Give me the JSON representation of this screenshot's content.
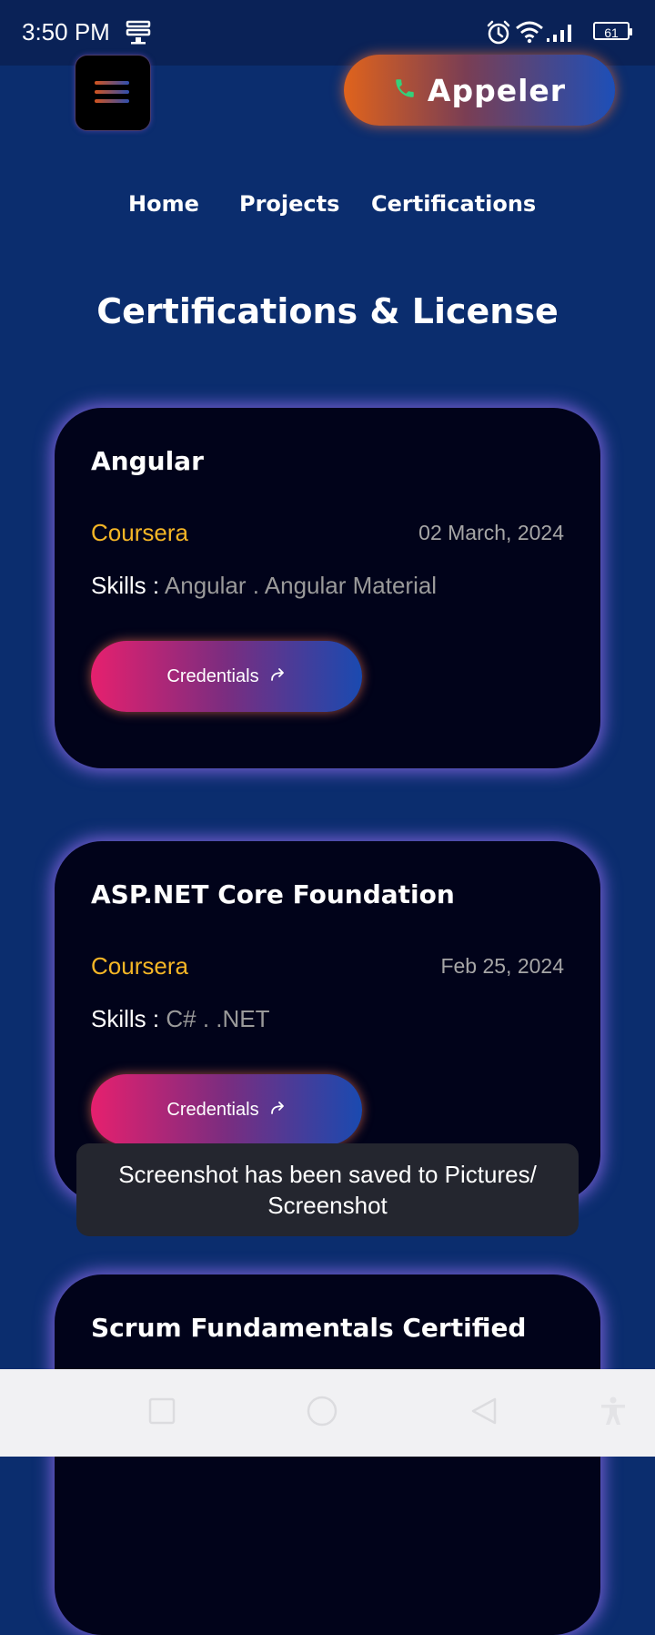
{
  "status_bar": {
    "time": "3:50 PM",
    "battery": "61"
  },
  "header": {
    "call_label": "Appeler"
  },
  "nav": {
    "links": [
      "Home",
      "Projects",
      "Certifications"
    ]
  },
  "section": {
    "title": "Certifications &  License"
  },
  "cards": [
    {
      "title": "Angular",
      "issuer": "Coursera",
      "date": "02 March, 2024",
      "skills_label": "Skills :",
      "skills": "Angular . Angular Material",
      "button_label": "Credentials"
    },
    {
      "title": "ASP.NET Core Foundation",
      "issuer": "Coursera",
      "date": "Feb 25, 2024",
      "skills_label": "Skills :",
      "skills": "C# . .NET",
      "button_label": "Credentials"
    },
    {
      "title": "Scrum Fundamentals Certified"
    }
  ],
  "toast": {
    "message": "Screenshot has been saved to  Pictures/ Screenshot"
  },
  "colors": {
    "background": "#0b2d6e",
    "card": "#01031a",
    "issuer": "#f5b626",
    "call_phone_icon": "#34d07a"
  }
}
